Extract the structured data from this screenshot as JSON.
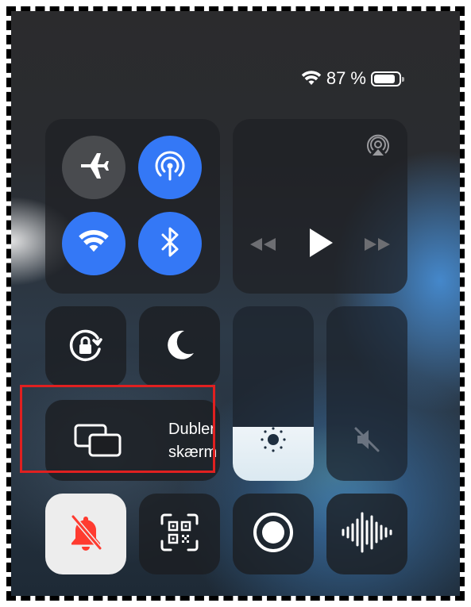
{
  "status_bar": {
    "battery_percent": "87 %",
    "battery_level": 0.87
  },
  "connectivity": {
    "airplane_mode": "off",
    "cellular_hotspot": "on",
    "wifi": "on",
    "bluetooth": "on"
  },
  "media": {
    "airplay_icon": "airplay-icon"
  },
  "screen_mirroring": {
    "label_line1": "Dubler",
    "label_line2": "skærm"
  },
  "brightness": {
    "level": 0.31
  },
  "volume": {
    "level": 0.0,
    "muted": true
  },
  "tiles": {
    "orientation_lock": "rotation-lock-icon",
    "focus": "moon-icon",
    "silent_mode": "bell-slash-icon",
    "qr_scanner": "qr-code-icon",
    "screen_recording": "record-icon",
    "sound_recognition": "waveform-icon"
  },
  "colors": {
    "accent_blue": "#3478f6",
    "silent_red": "#ff3b30",
    "highlight_red": "#e02020"
  }
}
